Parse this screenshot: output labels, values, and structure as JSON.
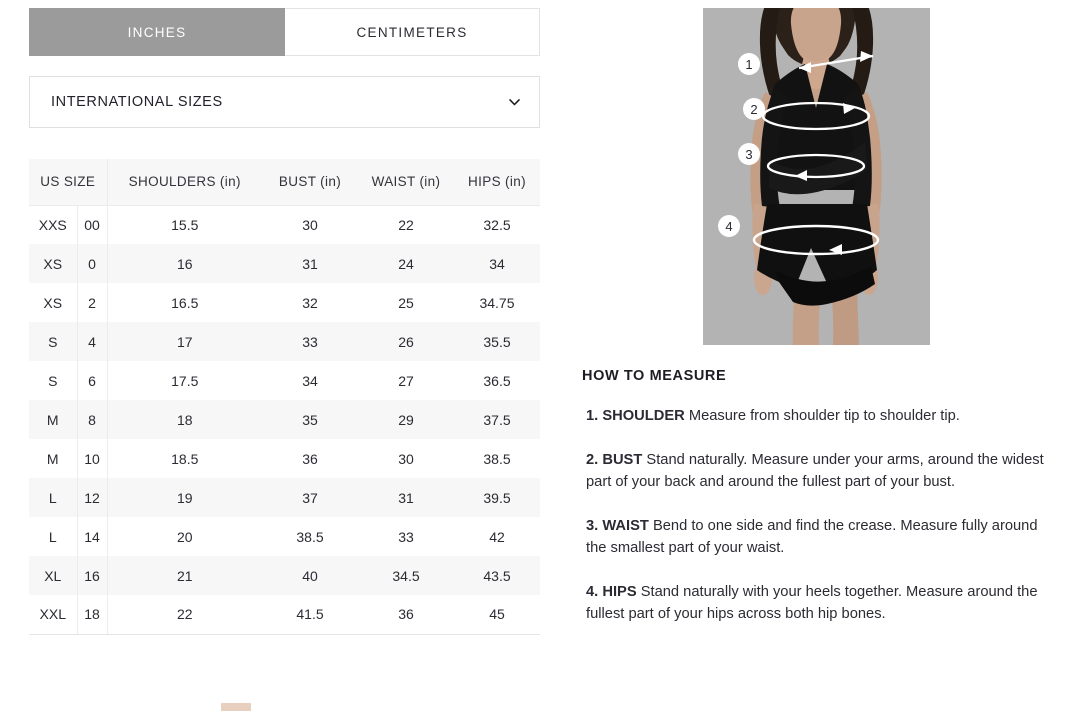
{
  "units": {
    "tabs": [
      {
        "label": "INCHES",
        "active": true
      },
      {
        "label": "CENTIMETERS",
        "active": false
      }
    ]
  },
  "international_sizes": {
    "label": "INTERNATIONAL SIZES",
    "icon": "chevron-down-icon",
    "expanded": false
  },
  "size_chart": {
    "headers": {
      "us_size": "US SIZE",
      "shoulders": "SHOULDERS (in)",
      "bust": "BUST (in)",
      "waist": "WAIST (in)",
      "hips": "HIPS (in)"
    },
    "rows": [
      {
        "alpha": "XXS",
        "numeric": "00",
        "shoulders": "15.5",
        "bust": "30",
        "waist": "22",
        "hips": "32.5"
      },
      {
        "alpha": "XS",
        "numeric": "0",
        "shoulders": "16",
        "bust": "31",
        "waist": "24",
        "hips": "34"
      },
      {
        "alpha": "XS",
        "numeric": "2",
        "shoulders": "16.5",
        "bust": "32",
        "waist": "25",
        "hips": "34.75"
      },
      {
        "alpha": "S",
        "numeric": "4",
        "shoulders": "17",
        "bust": "33",
        "waist": "26",
        "hips": "35.5"
      },
      {
        "alpha": "S",
        "numeric": "6",
        "shoulders": "17.5",
        "bust": "34",
        "waist": "27",
        "hips": "36.5"
      },
      {
        "alpha": "M",
        "numeric": "8",
        "shoulders": "18",
        "bust": "35",
        "waist": "29",
        "hips": "37.5"
      },
      {
        "alpha": "M",
        "numeric": "10",
        "shoulders": "18.5",
        "bust": "36",
        "waist": "30",
        "hips": "38.5"
      },
      {
        "alpha": "L",
        "numeric": "12",
        "shoulders": "19",
        "bust": "37",
        "waist": "31",
        "hips": "39.5"
      },
      {
        "alpha": "L",
        "numeric": "14",
        "shoulders": "20",
        "bust": "38.5",
        "waist": "33",
        "hips": "42"
      },
      {
        "alpha": "XL",
        "numeric": "16",
        "shoulders": "21",
        "bust": "40",
        "waist": "34.5",
        "hips": "43.5"
      },
      {
        "alpha": "XXL",
        "numeric": "18",
        "shoulders": "22",
        "bust": "41.5",
        "waist": "36",
        "hips": "45"
      }
    ]
  },
  "model_image": {
    "alt": "woman wearing black wrap dress with measurement guides",
    "markers": [
      {
        "number": "1",
        "measurement": "shoulder"
      },
      {
        "number": "2",
        "measurement": "bust"
      },
      {
        "number": "3",
        "measurement": "waist"
      },
      {
        "number": "4",
        "measurement": "hips"
      }
    ]
  },
  "how_to_measure": {
    "title": "HOW TO MEASURE",
    "items": [
      {
        "number": "1.",
        "term": "SHOULDER",
        "text": " Measure from shoulder tip to shoulder tip."
      },
      {
        "number": "2.",
        "term": "BUST",
        "text": "  Stand naturally. Measure under your arms, around the widest part of your back and around the fullest part of your bust."
      },
      {
        "number": "3.",
        "term": "WAIST",
        "text": " Bend to one side and find the crease. Measure fully around the smallest part of your waist."
      },
      {
        "number": "4.",
        "term": "HIPS",
        "text": " Stand naturally with your heels together. Measure around the fullest part of your hips across both hip bones."
      }
    ]
  },
  "colors": {
    "active_tab_bg": "#9b9b9b",
    "row_shade": "#f7f7f7",
    "border": "#ececec",
    "text": "#2b2b33",
    "photo_bg": "#b3b3b3"
  }
}
